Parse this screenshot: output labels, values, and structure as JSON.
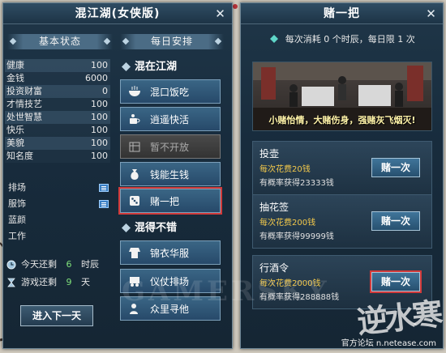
{
  "left_window": {
    "title": "混江湖(女侠版)",
    "left_section_title": "基本状态",
    "right_section_title": "每日安排",
    "stats": [
      {
        "label": "健康",
        "value": "100"
      },
      {
        "label": "金钱",
        "value": "6000"
      },
      {
        "label": "投资财富",
        "value": "0"
      },
      {
        "label": "才情技艺",
        "value": "100"
      },
      {
        "label": "处世智慧",
        "value": "100"
      },
      {
        "label": "快乐",
        "value": "100"
      },
      {
        "label": "美貌",
        "value": "100"
      },
      {
        "label": "知名度",
        "value": "100"
      }
    ],
    "attributes": [
      {
        "label": "排场",
        "icon": "list-icon"
      },
      {
        "label": "服饰",
        "icon": "list-icon"
      },
      {
        "label": "蓝颜",
        "icon": ""
      },
      {
        "label": "工作",
        "icon": ""
      }
    ],
    "today_remaining": {
      "label": "今天还剩",
      "value": "6",
      "unit": "时辰"
    },
    "game_remaining": {
      "label": "游戏还剩",
      "value": "9",
      "unit": "天"
    },
    "next_day_button": "进入下一天",
    "category_1": "混在江湖",
    "category_2": "混得不错",
    "actions_1": [
      {
        "label": "混口饭吃",
        "icon": "bowl-icon"
      },
      {
        "label": "逍遥快活",
        "icon": "tea-icon"
      },
      {
        "label": "暂不开放",
        "icon": "locked-icon"
      },
      {
        "label": "钱能生钱",
        "icon": "money-bag-icon"
      },
      {
        "label": "赌一把",
        "icon": "dice-icon"
      }
    ],
    "actions_2": [
      {
        "label": "锦衣华服",
        "icon": "robe-icon"
      },
      {
        "label": "仪仗排场",
        "icon": "carriage-icon"
      },
      {
        "label": "众里寻他",
        "icon": "search-person-icon"
      }
    ]
  },
  "right_window": {
    "title": "赌一把",
    "info": "每次消耗 0 个时辰，每日限 1 次",
    "scene_caption": "小赌怡情，大赌伤身，强赌灰飞烟灭!",
    "games": [
      {
        "name": "投壶",
        "cost": "每次花费20钱",
        "reward": "有概率获得23333钱",
        "button": "赌一次"
      },
      {
        "name": "抽花签",
        "cost": "每次花费200钱",
        "reward": "有概率获得99999钱",
        "button": "赌一次"
      },
      {
        "name": "行酒令",
        "cost": "每次花费2000钱",
        "reward": "有概率获得288888钱",
        "button": "赌一次"
      }
    ]
  },
  "overlay": {
    "watermark": "GAMERSKY",
    "brand": "逆水寒",
    "footer": "官方论坛 n.netease.com"
  },
  "colors": {
    "highlight": "#d23a3a",
    "cost_text": "#f2c84b",
    "remaining_value": "#7fe07a"
  }
}
